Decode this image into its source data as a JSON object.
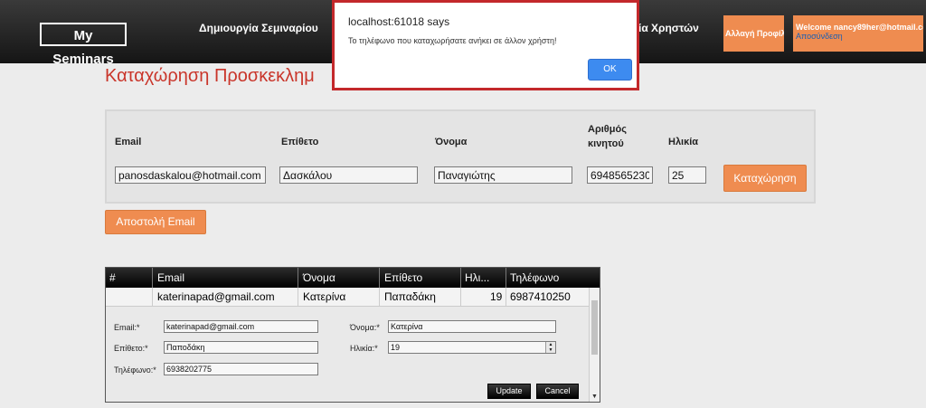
{
  "navbar": {
    "brand": "My Seminars",
    "create_seminar": "Δημιουργία Σεμιναρίου",
    "users": "ία Χρηστών",
    "change_profile": "Αλλαγή Προφίλ",
    "welcome": "Welcome nancy89her@hotmail.com",
    "logout": "Αποσύνδεση"
  },
  "page": {
    "title": "Καταχώρηση Προσκεκλημ"
  },
  "form": {
    "labels": {
      "email": "Email",
      "last_name": "Επίθετο",
      "first_name": "Όνομα",
      "mobile": "Αριθμός κινητού",
      "age": "Ηλικία"
    },
    "values": {
      "email": "panosdaskalou@hotmail.com",
      "last_name": "Δασκάλου",
      "first_name": "Παναγιώτης",
      "mobile": "6948565230",
      "age": "25"
    },
    "submit": "Καταχώρηση",
    "send_email": "Αποστολή Email"
  },
  "grid": {
    "columns": [
      "#",
      "Email",
      "Όνομα",
      "Επίθετο",
      "Ηλι...",
      "Τηλέφωνο"
    ],
    "row": {
      "email": "katerinapad@gmail.com",
      "first_name": "Κατερίνα",
      "last_name": "Παπαδάκη",
      "age": "19",
      "phone": "6987410250"
    },
    "edit": {
      "email_label": "Email:*",
      "email_value": "katerinapad@gmail.com",
      "last_name_label": "Επίθετο:*",
      "last_name_value": "Παποδάκη",
      "phone_label": "Τηλέφωνο:*",
      "phone_value": "6938202775",
      "first_name_label": "Όνομα:*",
      "first_name_value": "Κατερίνα",
      "age_label": "Ηλικία:*",
      "age_value": "19",
      "update": "Update",
      "cancel": "Cancel"
    }
  },
  "dialog": {
    "host": "localhost:61018 says",
    "message": "Το τηλέφωνο που καταχωρήσατε ανήκει σε άλλον χρήστη!",
    "ok": "OK"
  }
}
